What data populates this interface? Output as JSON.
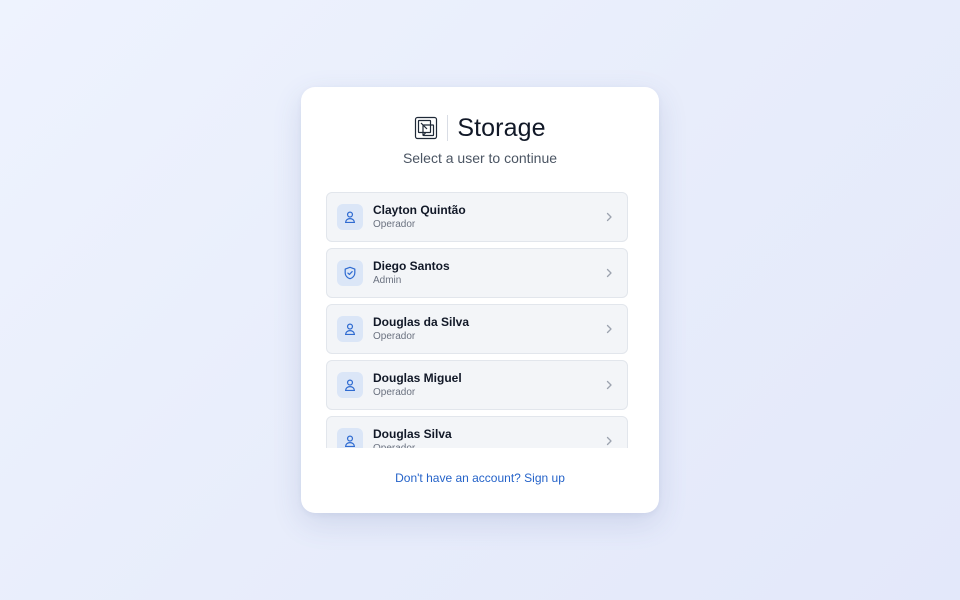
{
  "brand": {
    "name": "Storage",
    "logo_icon": "storage-box-icon"
  },
  "subtitle": "Select a user to continue",
  "users": [
    {
      "name": "Clayton Quintão",
      "role": "Operador",
      "icon": "user-icon"
    },
    {
      "name": "Diego Santos",
      "role": "Admin",
      "icon": "shield-check-icon"
    },
    {
      "name": "Douglas da Silva",
      "role": "Operador",
      "icon": "user-icon"
    },
    {
      "name": "Douglas Miguel",
      "role": "Operador",
      "icon": "user-icon"
    },
    {
      "name": "Douglas Silva",
      "role": "Operador",
      "icon": "user-icon"
    }
  ],
  "signup_link": "Don't have an account? Sign up",
  "colors": {
    "accent": "#2563c9",
    "avatar_bg": "#dbe6f7",
    "item_bg": "#f3f5f8"
  }
}
